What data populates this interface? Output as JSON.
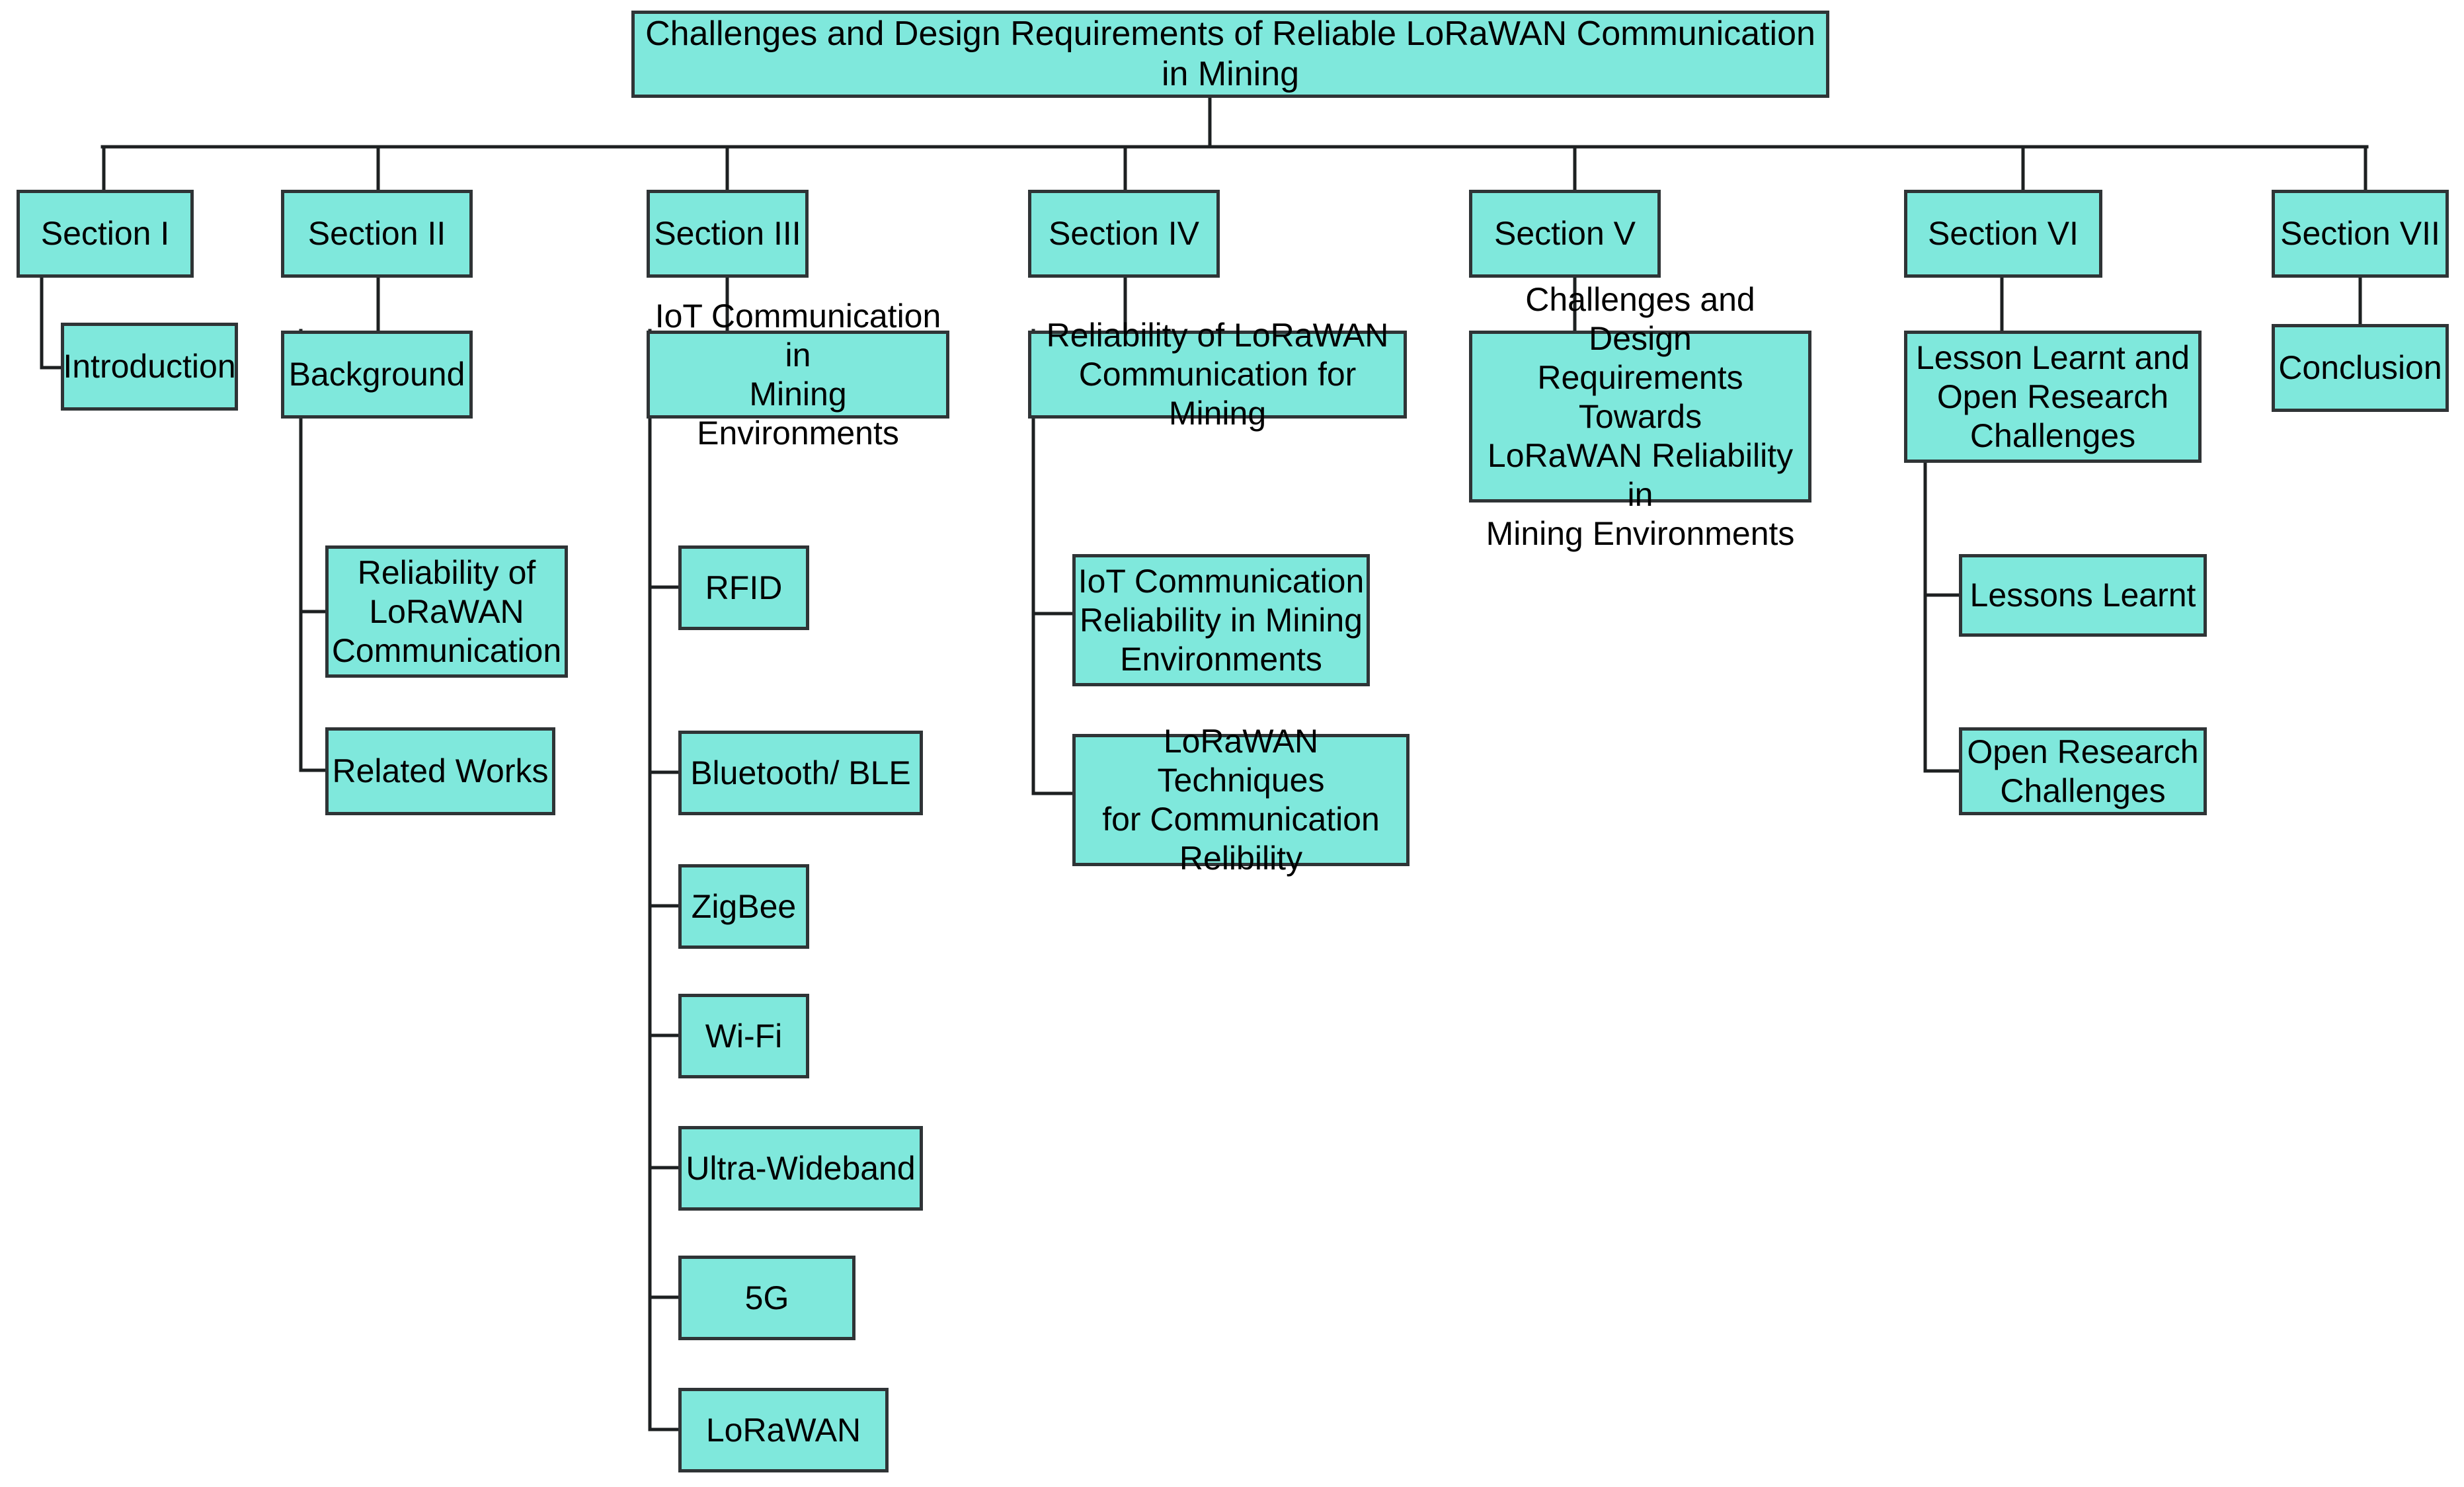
{
  "diagram": {
    "title": "Challenges and Design Requirements of Reliable LoRaWAN Communication in Mining",
    "accent_fill": "#7fe8dc",
    "border_color": "#2f3436",
    "background": "#ffffff",
    "root": {
      "label": "Challenges and Design Requirements of Reliable LoRaWAN Communication in Mining"
    },
    "sections": [
      {
        "id": "section-1",
        "label": "Section I",
        "topic": "Introduction",
        "children": []
      },
      {
        "id": "section-2",
        "label": "Section II",
        "topic": "Background",
        "children": [
          "Reliability of\nLoRaWAN\nCommunication",
          "Related Works"
        ]
      },
      {
        "id": "section-3",
        "label": "Section III",
        "topic": "IoT Communication in\nMining Environments",
        "children": [
          "RFID",
          "Bluetooth/ BLE",
          "ZigBee",
          "Wi-Fi",
          "Ultra-Wideband",
          "5G",
          "LoRaWAN"
        ]
      },
      {
        "id": "section-4",
        "label": "Section IV",
        "topic": "Reliability of LoRaWAN\nCommunication for Mining",
        "children": [
          "IoT Communication\nReliability in Mining\nEnvironments",
          "LoRaWAN Techniques\nfor Communication\nRelibility"
        ]
      },
      {
        "id": "section-5",
        "label": "Section V",
        "topic": "Challenges and Design\nRequirements Towards\nLoRaWAN Reliability in\nMining Environments",
        "children": []
      },
      {
        "id": "section-6",
        "label": "Section VI",
        "topic": "Lesson Learnt and\nOpen Research\nChallenges",
        "children": [
          "Lessons Learnt",
          "Open Research\nChallenges"
        ]
      },
      {
        "id": "section-7",
        "label": "Section VII",
        "topic": "Conclusion",
        "children": []
      }
    ]
  }
}
